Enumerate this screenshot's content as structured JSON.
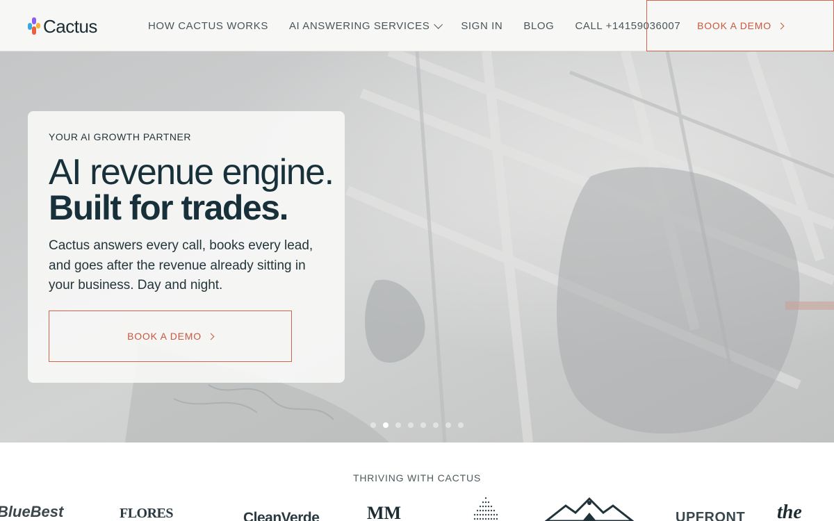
{
  "brand": {
    "name": "Cactus",
    "colors": {
      "accent": "#d2644a",
      "dark": "#17303a"
    }
  },
  "nav": {
    "items": [
      {
        "label": "HOW CACTUS WORKS"
      },
      {
        "label": "AI ANSWERING SERVICES"
      },
      {
        "label": "SIGN IN"
      },
      {
        "label": "BLOG"
      },
      {
        "label": "CALL +14159036007"
      }
    ],
    "cta": "BOOK A DEMO"
  },
  "hero": {
    "eyebrow": "YOUR AI GROWTH PARTNER",
    "headline_line1": "AI revenue engine.",
    "headline_line2": "Built for trades.",
    "description": "Cactus answers every call, books every lead, and goes after the revenue already sitting in your business. Day and night.",
    "cta": "BOOK A DEMO",
    "slides_total": 8,
    "active_slide": 2
  },
  "customers": {
    "heading": "THRIVING WITH CACTUS",
    "logos": [
      "BlueBest",
      "FLORES",
      "CleanVerde",
      "MM",
      "UPFRONT",
      "the"
    ]
  }
}
